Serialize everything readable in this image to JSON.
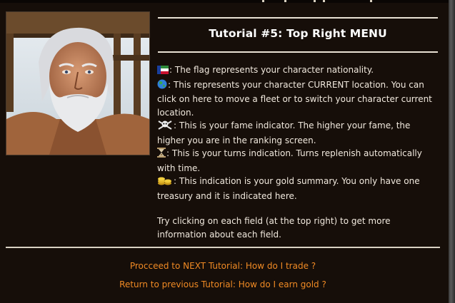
{
  "tutorial": {
    "title": "Tutorial #5: Top Right MENU",
    "items": [
      {
        "icon": "flag-icon",
        "text": ": The flag represents your character nationality."
      },
      {
        "icon": "globe-icon",
        "text": ": This represents your character CURRENT location. You can click on here to move a fleet or to switch your character current location."
      },
      {
        "icon": "skull-crossbones-icon",
        "text": ": This is your fame indicator. The higher your fame, the higher you are in the ranking screen."
      },
      {
        "icon": "hourglass-icon",
        "text": ": This is your turns indication. Turns replenish automatically with time."
      },
      {
        "icon": "gold-coins-icon",
        "text": ": This indication is your gold summary. You only have one treasury and it is indicated here."
      }
    ],
    "closing": "Try clicking on each field (at the top right) to get more information about each field."
  },
  "links": {
    "next": "Procceed to NEXT Tutorial: How do I trade ?",
    "previous": "Return to previous Tutorial: How do I earn gold ?"
  },
  "colors": {
    "background": "#160e09",
    "link": "#f08a24",
    "text": "#f1e9de"
  }
}
